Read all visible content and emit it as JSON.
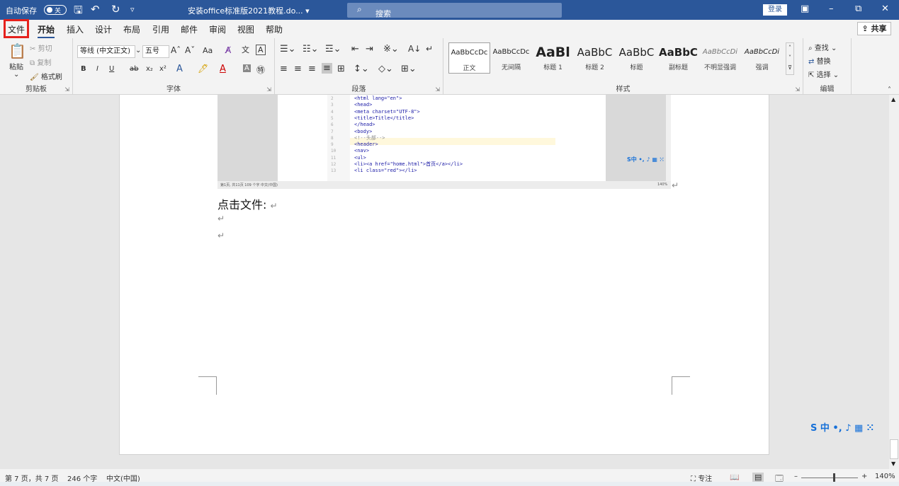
{
  "titlebar": {
    "autosave_label": "自动保存",
    "autosave_state": "关",
    "doc_title": "安装office标准版2021教程.do... ▾",
    "search_placeholder": "搜索",
    "login_label": "登录"
  },
  "tabs": [
    "文件",
    "开始",
    "插入",
    "设计",
    "布局",
    "引用",
    "邮件",
    "审阅",
    "视图",
    "帮助"
  ],
  "share_label": "共享",
  "ribbon": {
    "clipboard": {
      "paste": "粘贴",
      "cut": "剪切",
      "copy": "复制",
      "format_painter": "格式刷",
      "label": "剪贴板"
    },
    "font": {
      "name": "等线 (中文正文)",
      "size": "五号",
      "label": "字体",
      "aa_label": "Aa"
    },
    "paragraph": {
      "label": "段落"
    },
    "styles": {
      "label": "样式",
      "items": [
        {
          "sample": "AaBbCcDc",
          "name": "正文"
        },
        {
          "sample": "AaBbCcDc",
          "name": "无间隔"
        },
        {
          "sample": "AaBl",
          "name": "标题 1"
        },
        {
          "sample": "AaBbC",
          "name": "标题 2"
        },
        {
          "sample": "AaBbC",
          "name": "标题"
        },
        {
          "sample": "AaBbC",
          "name": "副标题"
        },
        {
          "sample": "AaBbCcDi",
          "name": "不明显强调"
        },
        {
          "sample": "AaBbCcDi",
          "name": "强调"
        }
      ]
    },
    "editing": {
      "find": "查找",
      "replace": "替换",
      "select": "选择",
      "label": "编辑"
    }
  },
  "document": {
    "code_lines": [
      {
        "n": "2",
        "text": "<html lang=\"en\">"
      },
      {
        "n": "3",
        "text": "<head>"
      },
      {
        "n": "4",
        "text": "  <meta charset=\"UTF-8\">"
      },
      {
        "n": "5",
        "text": "  <title>Title</title>"
      },
      {
        "n": "6",
        "text": "</head>"
      },
      {
        "n": "7",
        "text": "<body>"
      },
      {
        "n": "8",
        "text": "<!--头部-->"
      },
      {
        "n": "9",
        "text": "  <header>"
      },
      {
        "n": "10",
        "text": "    <nav>"
      },
      {
        "n": "11",
        "text": "      <ul>"
      },
      {
        "n": "12",
        "text": "        <li><a href=\"home.html\">首页</a></li>"
      },
      {
        "n": "13",
        "text": "        <li class=\"red\"></li>"
      }
    ],
    "embedded_status": "第1页, 共11页   109 个字   中文(中国)",
    "embedded_zoom": "140%",
    "paragraph_text": "点击文件:"
  },
  "statusbar": {
    "page": "第 7 页，共 7 页",
    "words": "246 个字",
    "language": "中文(中国)",
    "focus": "专注",
    "zoom": "140%"
  }
}
